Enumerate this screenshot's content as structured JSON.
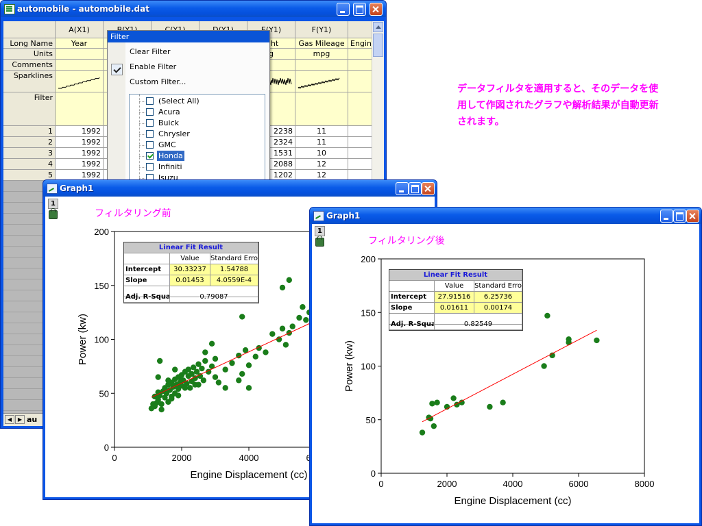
{
  "worksheet": {
    "title": "automobile - automobile.dat",
    "columns": [
      {
        "name": "A(X1)",
        "long_name": "Year",
        "units": ""
      },
      {
        "name": "B(Y1)",
        "long_name": "",
        "units": ""
      },
      {
        "name": "C(Y1)",
        "long_name": "",
        "units": ""
      },
      {
        "name": "D(Y1)",
        "long_name": "",
        "units": ""
      },
      {
        "name": "E(Y1)",
        "long_name": "ight",
        "units": "g"
      },
      {
        "name": "F(Y1)",
        "long_name": "Gas Mileage",
        "units": "mpg"
      },
      {
        "name": "",
        "long_name": "Engin",
        "units": ""
      }
    ],
    "row_labels": {
      "long_name": "Long Name",
      "units": "Units",
      "comments": "Comments",
      "sparklines": "Sparklines",
      "filter": "Filter"
    },
    "rows": [
      {
        "n": "1",
        "a": "1992",
        "e": "2238",
        "f": "11"
      },
      {
        "n": "2",
        "a": "1992",
        "e": "2324",
        "f": "11"
      },
      {
        "n": "3",
        "a": "1992",
        "e": "1531",
        "f": "10"
      },
      {
        "n": "4",
        "a": "1992",
        "e": "2088",
        "f": "12"
      },
      {
        "n": "5",
        "a": "1992",
        "e": "1202",
        "f": "12"
      }
    ],
    "sheet_tab": "au"
  },
  "filter_menu": {
    "header": "Filter",
    "items": [
      "Clear Filter",
      "Enable Filter",
      "Custom Filter..."
    ],
    "enable_checked": true,
    "list": [
      {
        "label": "(Select All)",
        "checked": false,
        "selected": false
      },
      {
        "label": "Acura",
        "checked": false,
        "selected": false
      },
      {
        "label": "Buick",
        "checked": false,
        "selected": false
      },
      {
        "label": "Chrysler",
        "checked": false,
        "selected": false
      },
      {
        "label": "GMC",
        "checked": false,
        "selected": false
      },
      {
        "label": "Honda",
        "checked": true,
        "selected": true
      },
      {
        "label": "Infiniti",
        "checked": false,
        "selected": false
      },
      {
        "label": "Isuzu",
        "checked": false,
        "selected": false
      }
    ]
  },
  "note": "データフィルタを適用すると、そのデータを使用して作図されたグラフや解析結果が自動更新されます。",
  "graph1": {
    "window_title": "Graph1",
    "page_number": "1",
    "title": "フィルタリング前",
    "fit": {
      "header": "Linear Fit Result",
      "value_col": "Value",
      "se_col": "Standard Error",
      "intercept_label": "Intercept",
      "intercept_value": "30.33237",
      "intercept_se": "1.54788",
      "slope_label": "Slope",
      "slope_value": "0.01453",
      "slope_se": "4.0559E-4",
      "adj_label": "Adj. R-Square",
      "adj_value": "0.79087"
    }
  },
  "graph2": {
    "window_title": "Graph1",
    "page_number": "1",
    "title": "フィルタリング後",
    "fit": {
      "header": "Linear Fit Result",
      "value_col": "Value",
      "se_col": "Standard Error",
      "intercept_label": "Intercept",
      "intercept_value": "27.91516",
      "intercept_se": "6.25736",
      "slope_label": "Slope",
      "slope_value": "0.01611",
      "slope_se": "0.00174",
      "adj_label": "Adj. R-Square",
      "adj_value": "0.82549"
    }
  },
  "colors": {
    "title_bar": "#0a5be8",
    "annotation": "#ff00ff",
    "points": "#1a7d1a",
    "fit_line": "#ff0000",
    "fit_highlight": "#ffff99"
  },
  "chart_data": [
    {
      "type": "scatter",
      "title": "",
      "xlabel": "Engine Displacement (cc)",
      "ylabel": "Power (kw)",
      "xlim": [
        0,
        8000
      ],
      "ylim": [
        0,
        200
      ],
      "x_ticks": [
        "0",
        "2000",
        "4000",
        "6000"
      ],
      "y_ticks": [
        "0",
        "50",
        "100",
        "150",
        "200"
      ],
      "fit": {
        "intercept": 30.33237,
        "slope": 0.01453
      },
      "points": [
        [
          1100,
          36
        ],
        [
          1150,
          40
        ],
        [
          1200,
          38
        ],
        [
          1200,
          47
        ],
        [
          1250,
          41
        ],
        [
          1300,
          44
        ],
        [
          1300,
          51
        ],
        [
          1350,
          48
        ],
        [
          1400,
          40
        ],
        [
          1450,
          52
        ],
        [
          1500,
          46
        ],
        [
          1500,
          55
        ],
        [
          1550,
          50
        ],
        [
          1600,
          58
        ],
        [
          1600,
          42
        ],
        [
          1650,
          53
        ],
        [
          1700,
          60
        ],
        [
          1700,
          47
        ],
        [
          1750,
          56
        ],
        [
          1800,
          63
        ],
        [
          1800,
          50
        ],
        [
          1850,
          58
        ],
        [
          1900,
          65
        ],
        [
          1900,
          54
        ],
        [
          1950,
          60
        ],
        [
          2000,
          67
        ],
        [
          2000,
          57
        ],
        [
          2050,
          62
        ],
        [
          2100,
          70
        ],
        [
          2150,
          59
        ],
        [
          2200,
          66
        ],
        [
          2200,
          72
        ],
        [
          2250,
          55
        ],
        [
          2300,
          68
        ],
        [
          2300,
          61
        ],
        [
          2350,
          74
        ],
        [
          2400,
          64
        ],
        [
          2450,
          70
        ],
        [
          2500,
          58
        ],
        [
          2500,
          77
        ],
        [
          2550,
          66
        ],
        [
          2600,
          73
        ],
        [
          2650,
          62
        ],
        [
          2700,
          80
        ],
        [
          2800,
          70
        ],
        [
          2900,
          75
        ],
        [
          3000,
          82
        ],
        [
          3100,
          60
        ],
        [
          3300,
          72
        ],
        [
          3500,
          78
        ],
        [
          3700,
          85
        ],
        [
          3800,
          68
        ],
        [
          3900,
          90
        ],
        [
          4000,
          76
        ],
        [
          4200,
          84
        ],
        [
          4300,
          92
        ],
        [
          4500,
          88
        ],
        [
          4700,
          105
        ],
        [
          4900,
          100
        ],
        [
          5000,
          110
        ],
        [
          5100,
          95
        ],
        [
          5200,
          106
        ],
        [
          5300,
          112
        ],
        [
          5500,
          120
        ],
        [
          5600,
          130
        ],
        [
          5700,
          118
        ],
        [
          5800,
          125
        ],
        [
          2200,
          72
        ],
        [
          2400,
          58
        ],
        [
          1800,
          72
        ],
        [
          1600,
          62
        ],
        [
          2000,
          62
        ],
        [
          3800,
          121
        ],
        [
          5000,
          148
        ],
        [
          5200,
          155
        ],
        [
          1350,
          80
        ],
        [
          1300,
          65
        ],
        [
          1700,
          45
        ],
        [
          2900,
          96
        ],
        [
          2700,
          88
        ],
        [
          1900,
          48
        ],
        [
          1400,
          35
        ],
        [
          2100,
          55
        ],
        [
          3000,
          65
        ],
        [
          3300,
          55
        ],
        [
          3700,
          62
        ],
        [
          4000,
          55
        ]
      ]
    },
    {
      "type": "scatter",
      "title": "",
      "xlabel": "Engine Displacement (cc)",
      "ylabel": "Power (kw)",
      "xlim": [
        0,
        8000
      ],
      "ylim": [
        0,
        200
      ],
      "x_ticks": [
        "0",
        "2000",
        "4000",
        "6000",
        "8000"
      ],
      "y_ticks": [
        "0",
        "50",
        "100",
        "150",
        "200"
      ],
      "fit": {
        "intercept": 27.91516,
        "slope": 0.01611
      },
      "points": [
        [
          1250,
          38
        ],
        [
          1450,
          52
        ],
        [
          1500,
          51
        ],
        [
          1550,
          65
        ],
        [
          1600,
          44
        ],
        [
          1700,
          66
        ],
        [
          2000,
          62
        ],
        [
          2200,
          70
        ],
        [
          2300,
          64
        ],
        [
          2450,
          66
        ],
        [
          3300,
          62
        ],
        [
          3700,
          66
        ],
        [
          4950,
          100
        ],
        [
          5050,
          147
        ],
        [
          5200,
          110
        ],
        [
          5700,
          122
        ],
        [
          5700,
          125
        ],
        [
          6550,
          124
        ]
      ]
    }
  ]
}
